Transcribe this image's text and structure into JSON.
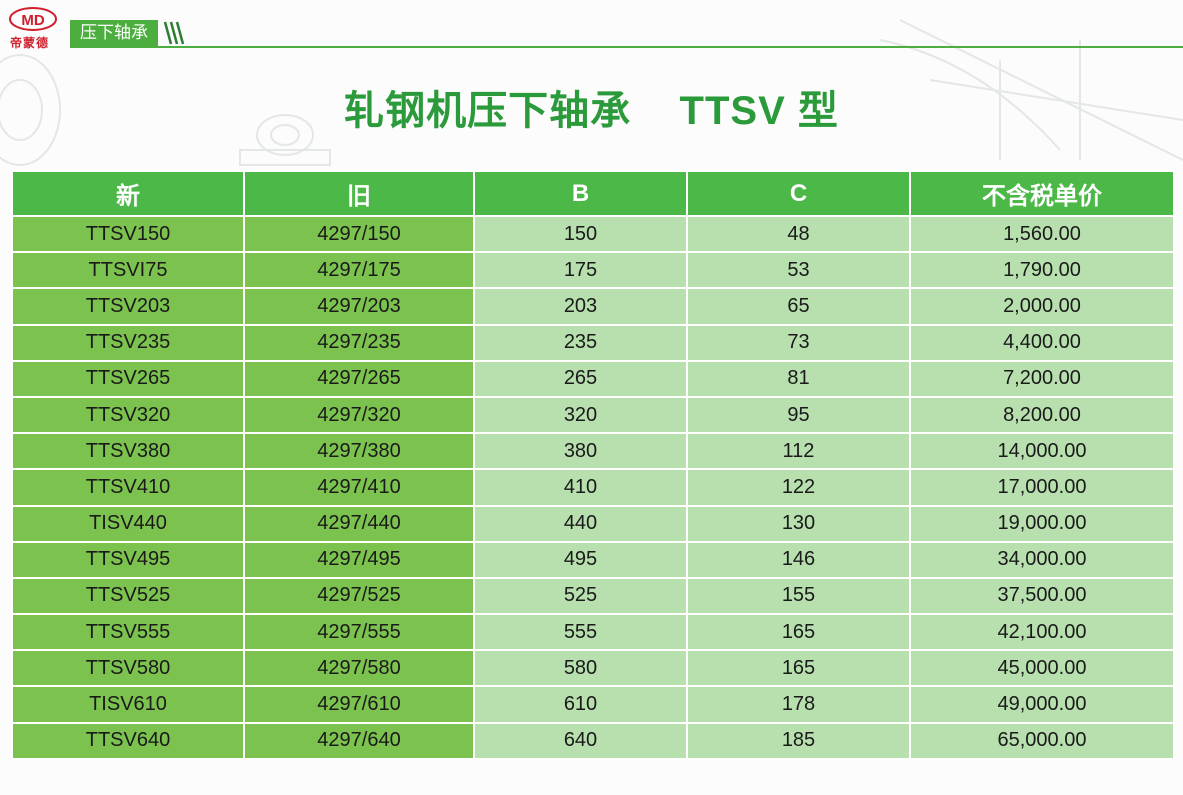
{
  "logo": {
    "mark": "MD",
    "name": "帝蒙德"
  },
  "section": {
    "label": "压下轴承"
  },
  "title": "轧钢机压下轴承    TTSV 型",
  "colors": {
    "accent": "#4cb848",
    "title": "#2a9a3a",
    "cell_dark": "#7cc24f",
    "cell_light": "#b7e0ae",
    "logo_red": "#d0202e"
  },
  "table": {
    "headers": [
      "新",
      "旧",
      "B",
      "C",
      "不含税单价"
    ],
    "rows": [
      [
        "TTSV150",
        "4297/150",
        "150",
        "48",
        "1,560.00"
      ],
      [
        "TTSVI75",
        "4297/175",
        "175",
        "53",
        "1,790.00"
      ],
      [
        "TTSV203",
        "4297/203",
        "203",
        "65",
        "2,000.00"
      ],
      [
        "TTSV235",
        "4297/235",
        "235",
        "73",
        "4,400.00"
      ],
      [
        "TTSV265",
        "4297/265",
        "265",
        "81",
        "7,200.00"
      ],
      [
        "TTSV320",
        "4297/320",
        "320",
        "95",
        "8,200.00"
      ],
      [
        "TTSV380",
        "4297/380",
        "380",
        "112",
        "14,000.00"
      ],
      [
        "TTSV410",
        "4297/410",
        "410",
        "122",
        "17,000.00"
      ],
      [
        "TISV440",
        "4297/440",
        "440",
        "130",
        "19,000.00"
      ],
      [
        "TTSV495",
        "4297/495",
        "495",
        "146",
        "34,000.00"
      ],
      [
        "TTSV525",
        "4297/525",
        "525",
        "155",
        "37,500.00"
      ],
      [
        "TTSV555",
        "4297/555",
        "555",
        "165",
        "42,100.00"
      ],
      [
        "TTSV580",
        "4297/580",
        "580",
        "165",
        "45,000.00"
      ],
      [
        "TISV610",
        "4297/610",
        "610",
        "178",
        "49,000.00"
      ],
      [
        "TTSV640",
        "4297/640",
        "640",
        "185",
        "65,000.00"
      ]
    ]
  }
}
